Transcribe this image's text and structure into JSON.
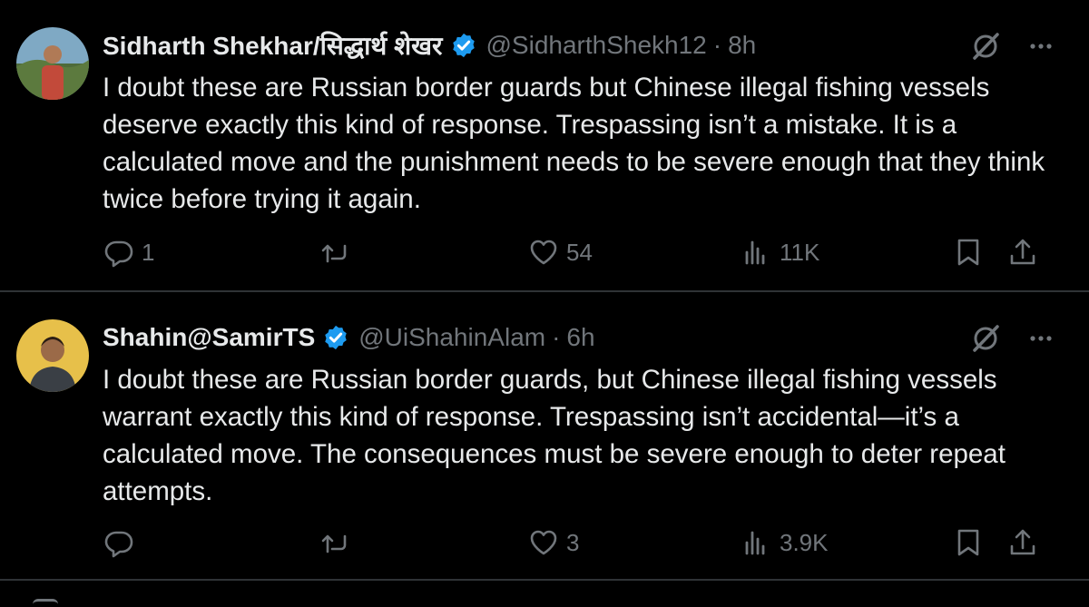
{
  "tweets": [
    {
      "author_name": "Sidharth Shekhar/सिद्धार्थ शेखर",
      "verified": true,
      "handle": "@SidharthShekh12",
      "separator": "·",
      "time": "8h",
      "text": "I doubt these are Russian border guards but Chinese illegal fishing vessels deserve exactly this kind of response. Trespassing isn’t a mistake. It is a calculated move and the punishment needs to be severe enough that they think twice before trying it again.",
      "replies": "1",
      "retweets": "",
      "likes": "54",
      "views": "11K",
      "icons": [
        "grok-icon",
        "more-icon",
        "reply-icon",
        "retweet-icon",
        "like-icon",
        "views-icon",
        "bookmark-icon",
        "share-icon"
      ]
    },
    {
      "author_name": "Shahin@SamirTS",
      "verified": true,
      "handle": "@UiShahinAlam",
      "separator": "·",
      "time": "6h",
      "text": "I doubt these are Russian border guards, but Chinese illegal fishing vessels warrant exactly this kind of response. Trespassing isn’t accidental—it’s a calculated move. The consequences must be severe enough to deter repeat attempts.",
      "replies": "",
      "retweets": "",
      "likes": "3",
      "views": "3.9K",
      "icons": [
        "grok-icon",
        "more-icon",
        "reply-icon",
        "retweet-icon",
        "like-icon",
        "views-icon",
        "bookmark-icon",
        "share-icon"
      ]
    }
  ],
  "colors": {
    "background": "#000000",
    "text": "#e7e9ea",
    "secondary": "#71767b",
    "verified": "#1d9bf0",
    "divider": "#2f3336"
  }
}
